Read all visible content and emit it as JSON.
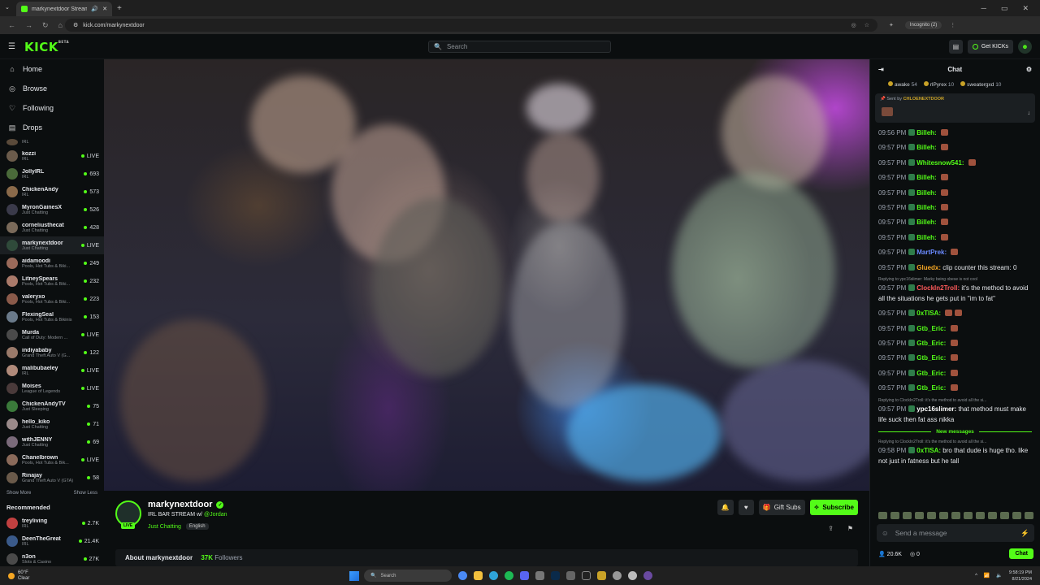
{
  "browser": {
    "tab_title": "markynextdoor Stream - W",
    "new_tab": "+",
    "url": "kick.com/markynextdoor",
    "incognito": "Incognito (2)"
  },
  "header": {
    "logo": "KICK",
    "logo_beta": "BETA",
    "search_placeholder": "Search",
    "get_kicks": "Get KICKs"
  },
  "sidebar": {
    "nav": [
      {
        "label": "Home",
        "icon": "home-icon"
      },
      {
        "label": "Browse",
        "icon": "compass-icon"
      },
      {
        "label": "Following",
        "icon": "heart-icon"
      },
      {
        "label": "Drops",
        "icon": "gift-icon"
      }
    ],
    "following": [
      {
        "name": "",
        "category": "IRL",
        "viewers": "",
        "color": "#5a4a3a"
      },
      {
        "name": "kozzi",
        "category": "IRL",
        "viewers": "LIVE",
        "color": "#6b5b4b"
      },
      {
        "name": "JollyIRL",
        "category": "IRL",
        "viewers": "693",
        "color": "#4a6a3a"
      },
      {
        "name": "ChickenAndy",
        "category": "IRL",
        "viewers": "573",
        "color": "#8a6a4a"
      },
      {
        "name": "MyronGainesX",
        "category": "Just Chatting",
        "viewers": "526",
        "color": "#3a3a4a"
      },
      {
        "name": "corneliusthecat",
        "category": "Just Chatting",
        "viewers": "428",
        "color": "#7a6a5a"
      },
      {
        "name": "markynextdoor",
        "category": "Just Chatting",
        "viewers": "LIVE",
        "color": "#2f4a3a"
      },
      {
        "name": "aidamoodi",
        "category": "Pools, Hot Tubs & Biki...",
        "viewers": "249",
        "color": "#9a6a5a"
      },
      {
        "name": "LitneySpears",
        "category": "Pools, Hot Tubs & Biki...",
        "viewers": "232",
        "color": "#aa7a6a"
      },
      {
        "name": "valeryxo",
        "category": "Pools, Hot Tubs & Biki...",
        "viewers": "223",
        "color": "#8a5a4a"
      },
      {
        "name": "FlexingSeal",
        "category": "Pools, Hot Tubs & Bikinis",
        "viewers": "153",
        "color": "#6a7a8a"
      },
      {
        "name": "Murda",
        "category": "Call of Duty: Modern ...",
        "viewers": "LIVE",
        "color": "#4a4a4a"
      },
      {
        "name": "indiyababy",
        "category": "Grand Theft Auto V (G...",
        "viewers": "122",
        "color": "#9a7a6a"
      },
      {
        "name": "malibubaeley",
        "category": "IRL",
        "viewers": "LIVE",
        "color": "#b08a7a"
      },
      {
        "name": "Moises",
        "category": "League of Legends",
        "viewers": "LIVE",
        "color": "#4a3a3a"
      },
      {
        "name": "ChickenAndyTV",
        "category": "Just Sleeping",
        "viewers": "75",
        "color": "#3a7a3a"
      },
      {
        "name": "hello_kiko",
        "category": "Just Chatting",
        "viewers": "71",
        "color": "#9a8a8a"
      },
      {
        "name": "withJENNY",
        "category": "Just Chatting",
        "viewers": "69",
        "color": "#7a6a7a"
      },
      {
        "name": "Chanelbrown",
        "category": "Pools, Hot Tubs & Bik...",
        "viewers": "LIVE",
        "color": "#8a6a5a"
      },
      {
        "name": "Rinajay",
        "category": "Grand Theft Auto V (GTA)",
        "viewers": "58",
        "color": "#6a5a4a"
      }
    ],
    "show_more": "Show More",
    "show_less": "Show Less",
    "recommended_title": "Recommended",
    "recommended": [
      {
        "name": "treyliving",
        "category": "IRL",
        "viewers": "2.7K",
        "color": "#c04040"
      },
      {
        "name": "DeenTheGreat",
        "category": "IRL",
        "viewers": "21.4K",
        "color": "#3a5a8a"
      },
      {
        "name": "n3on",
        "category": "Slots & Casino",
        "viewers": "27K",
        "color": "#4a4a4a"
      }
    ]
  },
  "stream": {
    "streamer": "markynextdoor",
    "live_badge": "LIVE",
    "title_prefix": "IRL BAR STREAM w/",
    "title_mention": "@Jordan",
    "category": "Just Chatting",
    "language": "English",
    "gift_subs": "Gift Subs",
    "subscribe": "Subscribe",
    "about_label": "About markynextdoor",
    "followers_count": "37K",
    "followers_label": "Followers"
  },
  "chat": {
    "title": "Chat",
    "leaderboard": [
      {
        "name": "awake",
        "points": "54"
      },
      {
        "name": "rlPyrex",
        "points": "10"
      },
      {
        "name": "sweatergxd",
        "points": "10"
      }
    ],
    "pinned_label": "Sent by",
    "pinned_user": "CHLOENEXTDOOR",
    "messages": [
      {
        "time": "09:56 PM",
        "user": "Billeh:",
        "color": "#53fc18",
        "text": "",
        "emotes": 1
      },
      {
        "time": "09:57 PM",
        "user": "Billeh:",
        "color": "#53fc18",
        "text": "",
        "emotes": 1
      },
      {
        "time": "09:57 PM",
        "user": "Whitesnow541:",
        "color": "#53fc18",
        "text": "",
        "emotes": 1
      },
      {
        "time": "09:57 PM",
        "user": "Billeh:",
        "color": "#53fc18",
        "text": "",
        "emotes": 1
      },
      {
        "time": "09:57 PM",
        "user": "Billeh:",
        "color": "#53fc18",
        "text": "",
        "emotes": 1
      },
      {
        "time": "09:57 PM",
        "user": "Billeh:",
        "color": "#53fc18",
        "text": "",
        "emotes": 1
      },
      {
        "time": "09:57 PM",
        "user": "Billeh:",
        "color": "#53fc18",
        "text": "",
        "emotes": 1
      },
      {
        "time": "09:57 PM",
        "user": "Billeh:",
        "color": "#53fc18",
        "text": "",
        "emotes": 1
      },
      {
        "time": "09:57 PM",
        "user": "MartPrek:",
        "color": "#6a8aff",
        "text": "",
        "emotes": 1
      },
      {
        "time": "09:57 PM",
        "user": "Gluedx:",
        "color": "#f5a623",
        "text": "clip counter this stream: 0",
        "emotes": 0
      },
      {
        "time": "09:57 PM",
        "user": "ClockIn2Troll:",
        "color": "#ff5a5a",
        "text": "it's the method to avoid all the situations he gets put in \"im to fat\"",
        "emotes": 0,
        "reply": "Replying to ypc16slimer: Marky being obese is not cool"
      },
      {
        "time": "09:57 PM",
        "user": "0xTISA:",
        "color": "#53fc18",
        "text": "",
        "emotes": 2
      },
      {
        "time": "09:57 PM",
        "user": "Gtb_Eric:",
        "color": "#53fc18",
        "text": "",
        "emotes": 1
      },
      {
        "time": "09:57 PM",
        "user": "Gtb_Eric:",
        "color": "#53fc18",
        "text": "",
        "emotes": 1
      },
      {
        "time": "09:57 PM",
        "user": "Gtb_Eric:",
        "color": "#53fc18",
        "text": "",
        "emotes": 1
      },
      {
        "time": "09:57 PM",
        "user": "Gtb_Eric:",
        "color": "#53fc18",
        "text": "",
        "emotes": 1
      },
      {
        "time": "09:57 PM",
        "user": "Gtb_Eric:",
        "color": "#53fc18",
        "text": "",
        "emotes": 1
      },
      {
        "time": "09:57 PM",
        "user": "ypc16slimer:",
        "color": "#ffffff",
        "text": "that method must make life suck then fat ass nikka",
        "emotes": 0,
        "reply": "Replying to ClockIn2Troll: it's the method to avoid all the si..."
      }
    ],
    "new_messages": "New messages",
    "last_message": {
      "time": "09:58 PM",
      "user": "0xTISA:",
      "text": "bro that dude is huge tho. like not just in fatness but he tall",
      "reply": "Replying to ClockIn2Troll: it's the method to avoid all the si..."
    },
    "input_placeholder": "Send a message",
    "viewers": "20.6K",
    "points": "0",
    "chat_button": "Chat"
  },
  "taskbar": {
    "temp": "60°F",
    "weather": "Clear",
    "search": "Search",
    "time": "9:58:19 PM",
    "date": "8/21/2024"
  }
}
